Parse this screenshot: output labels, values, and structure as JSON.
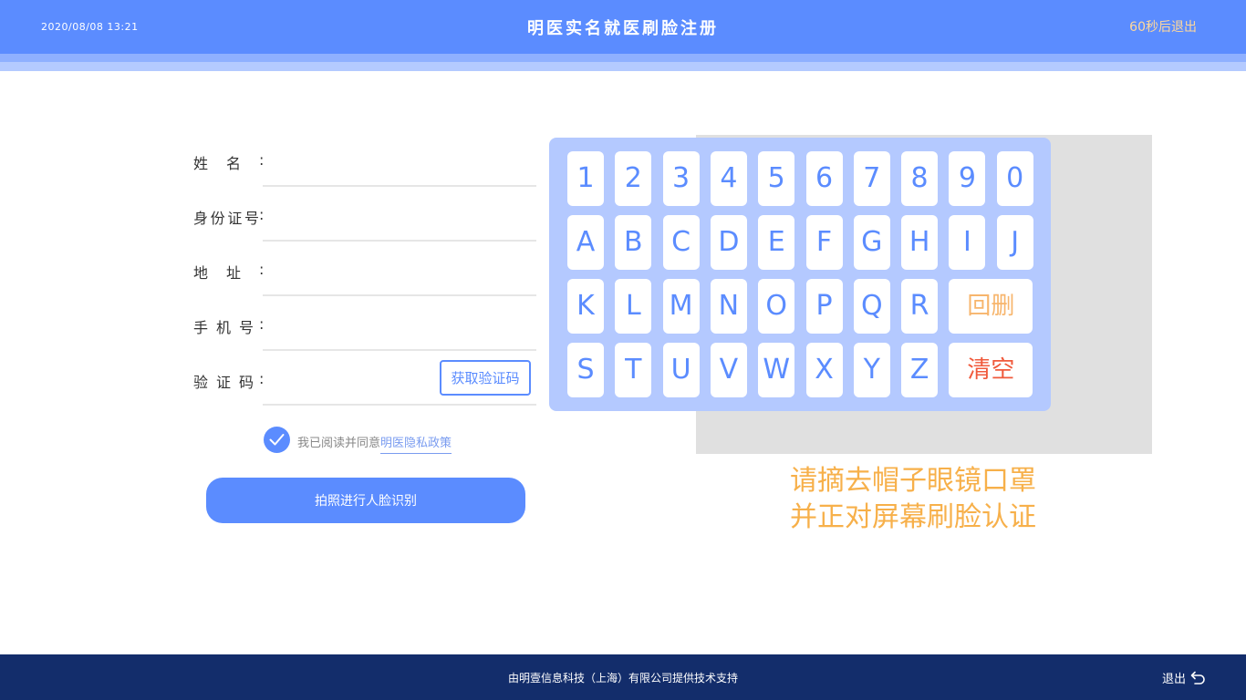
{
  "header": {
    "datetime": "2020/08/08   13:21",
    "title": "明医实名就医刷脸注册",
    "countdown": "60秒后退出"
  },
  "form": {
    "name_label": "姓名",
    "id_label": "身份证号",
    "address_label": "地址",
    "phone_label": "手机号",
    "code_label": "验证码",
    "colon": ":",
    "get_code_button": "获取验证码"
  },
  "agreement": {
    "prefix": "我已阅读并同意",
    "policy_link": "明医隐私政策",
    "checked": true
  },
  "submit_button": "拍照进行人脸识别",
  "keyboard": {
    "row1": [
      "1",
      "2",
      "3",
      "4",
      "5",
      "6",
      "7",
      "8",
      "9",
      "0"
    ],
    "row2": [
      "A",
      "B",
      "C",
      "D",
      "E",
      "F",
      "G",
      "H",
      "I",
      "J"
    ],
    "row3": [
      "K",
      "L",
      "M",
      "N",
      "O",
      "P",
      "Q",
      "R"
    ],
    "row4": [
      "S",
      "T",
      "U",
      "V",
      "W",
      "X",
      "Y",
      "Z"
    ],
    "backspace": "回删",
    "clear": "清空"
  },
  "instructions": {
    "line1": "请摘去帽子眼镜口罩",
    "line2": "并正对屏幕刷脸认证"
  },
  "footer": {
    "support_text": "由明壹信息科技（上海）有限公司提供技术支持",
    "exit_label": "退出"
  },
  "colors": {
    "primary": "#5b8cff",
    "footer": "#132d6b",
    "accent_orange": "#f7b04a",
    "clear_red": "#f05a3c"
  },
  "icons": {
    "check": "check-icon",
    "exit": "return-arrow-icon"
  }
}
